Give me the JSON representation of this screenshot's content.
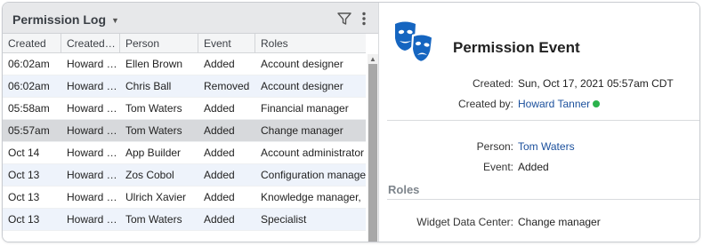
{
  "left_panel": {
    "title": "Permission Log",
    "columns": [
      "Created",
      "Created…",
      "Person",
      "Event",
      "Roles"
    ],
    "rows": [
      {
        "created": "06:02am",
        "created_by": "Howard …",
        "person": "Ellen Brown",
        "event": "Added",
        "roles": "Account designer"
      },
      {
        "created": "06:02am",
        "created_by": "Howard …",
        "person": "Chris Ball",
        "event": "Removed",
        "roles": "Account designer"
      },
      {
        "created": "05:58am",
        "created_by": "Howard …",
        "person": "Tom Waters",
        "event": "Added",
        "roles": "Financial manager"
      },
      {
        "created": "05:57am",
        "created_by": "Howard …",
        "person": "Tom Waters",
        "event": "Added",
        "roles": "Change manager"
      },
      {
        "created": "Oct 14",
        "created_by": "Howard …",
        "person": "App Builder",
        "event": "Added",
        "roles": "Account administrator"
      },
      {
        "created": "Oct 13",
        "created_by": "Howard …",
        "person": "Zos Cobol",
        "event": "Added",
        "roles": "Configuration manager"
      },
      {
        "created": "Oct 13",
        "created_by": "Howard …",
        "person": "Ulrich Xavier",
        "event": "Added",
        "roles": "Knowledge manager,"
      },
      {
        "created": "Oct 13",
        "created_by": "Howard …",
        "person": "Tom Waters",
        "event": "Added",
        "roles": "Specialist"
      }
    ],
    "selected_row_index": 3
  },
  "detail": {
    "title": "Permission Event",
    "created_label": "Created:",
    "created_value": "Sun, Oct 17, 2021 05:57am CDT",
    "created_by_label": "Created by:",
    "created_by_value": "Howard Tanner",
    "person_label": "Person:",
    "person_value": "Tom Waters",
    "event_label": "Event:",
    "event_value": "Added",
    "roles_section": "Roles",
    "role_label": "Widget Data Center:",
    "role_value": "Change manager"
  },
  "icons": {
    "title_caret": "caret-down-icon",
    "filter": "filter-icon",
    "more": "more-vertical-icon",
    "detail": "theater-masks-icon",
    "presence": "online-status-dot"
  },
  "colors": {
    "header_bg": "#e7e8ea",
    "alt_row": "#eef3fb",
    "selected_row": "#d7d9dc",
    "link": "#1a4f9c",
    "icon_blue": "#1565c0",
    "online_green": "#2bb24c",
    "section_label": "#7e858c"
  }
}
